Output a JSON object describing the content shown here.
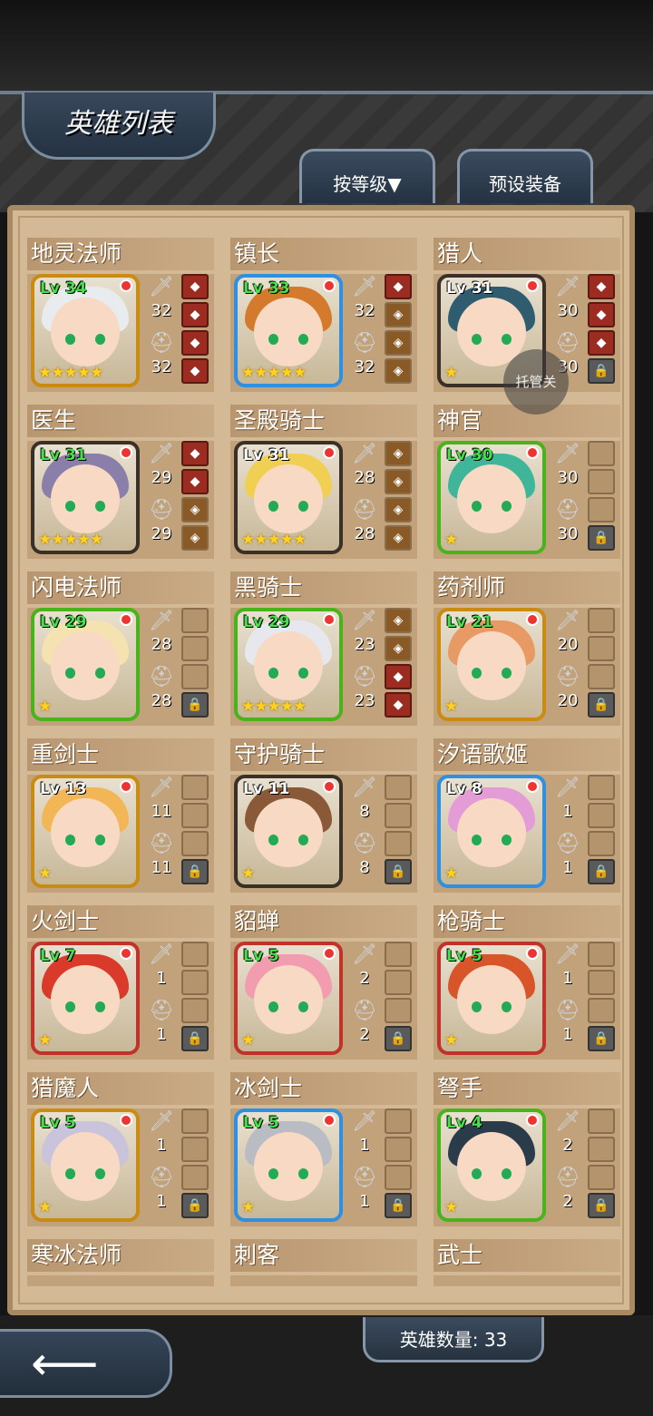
{
  "header": {
    "title": "英雄列表"
  },
  "tabs": {
    "sort_label": "按等级▼",
    "preset_label": "预设装备"
  },
  "footer": {
    "hero_count": "英雄数量: 33"
  },
  "overlay": {
    "label": "托管关"
  },
  "colors": {
    "green_frame": "#4ab31c",
    "blue_frame": "#2f8fe0",
    "gold_frame": "#c98b12",
    "red_frame": "#c0322a",
    "dark_frame": "#3a3028"
  },
  "heroes": [
    {
      "name": "地灵法师",
      "level": "Lv 34",
      "atk": "32",
      "def": "32",
      "stars": 5,
      "frame": "#c98b12",
      "hair": "#e9ecef",
      "lvwhite": false,
      "slots": [
        "f",
        "f",
        "f",
        "f"
      ]
    },
    {
      "name": "镇长",
      "level": "Lv 33",
      "atk": "32",
      "def": "32",
      "stars": 5,
      "frame": "#2f8fe0",
      "hair": "#d47a2c",
      "lvwhite": false,
      "slots": [
        "f",
        "b",
        "b",
        "b"
      ]
    },
    {
      "name": "猎人",
      "level": "Lv 31",
      "atk": "30",
      "def": "30",
      "stars": 1,
      "frame": "#3a3028",
      "hair": "#2f5c6e",
      "lvwhite": true,
      "slots": [
        "f",
        "f",
        "f",
        "lock"
      ]
    },
    {
      "name": "医生",
      "level": "Lv 31",
      "atk": "29",
      "def": "29",
      "stars": 5,
      "frame": "#3a3028",
      "hair": "#8a7fa8",
      "lvwhite": false,
      "slots": [
        "f",
        "f",
        "b",
        "b"
      ]
    },
    {
      "name": "圣殿骑士",
      "level": "Lv 31",
      "atk": "28",
      "def": "28",
      "stars": 5,
      "frame": "#3a3028",
      "hair": "#f0cf52",
      "lvwhite": true,
      "slots": [
        "b",
        "b",
        "b",
        "b"
      ]
    },
    {
      "name": "神官",
      "level": "Lv 30",
      "atk": "30",
      "def": "30",
      "stars": 1,
      "frame": "#4ab31c",
      "hair": "#3fb59a",
      "lvwhite": false,
      "slots": [
        "e",
        "e",
        "e",
        "lock"
      ]
    },
    {
      "name": "闪电法师",
      "level": "Lv 29",
      "atk": "28",
      "def": "28",
      "stars": 1,
      "frame": "#4ab31c",
      "hair": "#f4e3b0",
      "lvwhite": false,
      "slots": [
        "e",
        "e",
        "e",
        "lock"
      ]
    },
    {
      "name": "黑骑士",
      "level": "Lv 29",
      "atk": "23",
      "def": "23",
      "stars": 5,
      "frame": "#4ab31c",
      "hair": "#e7e7ee",
      "lvwhite": false,
      "slots": [
        "b",
        "b",
        "f",
        "f"
      ]
    },
    {
      "name": "药剂师",
      "level": "Lv 21",
      "atk": "20",
      "def": "20",
      "stars": 1,
      "frame": "#c98b12",
      "hair": "#e89a64",
      "lvwhite": false,
      "slots": [
        "e",
        "e",
        "e",
        "lock"
      ]
    },
    {
      "name": "重剑士",
      "level": "Lv 13",
      "atk": "11",
      "def": "11",
      "stars": 1,
      "frame": "#c98b12",
      "hair": "#f2b657",
      "lvwhite": true,
      "slots": [
        "e",
        "e",
        "e",
        "lock"
      ]
    },
    {
      "name": "守护骑士",
      "level": "Lv 11",
      "atk": "8",
      "def": "8",
      "stars": 1,
      "frame": "#3a3028",
      "hair": "#8a5a38",
      "lvwhite": true,
      "slots": [
        "e",
        "e",
        "e",
        "lock"
      ]
    },
    {
      "name": "汐语歌姬",
      "level": "Lv 8",
      "atk": "1",
      "def": "1",
      "stars": 1,
      "frame": "#2f8fe0",
      "hair": "#e49cd6",
      "lvwhite": true,
      "slots": [
        "e",
        "e",
        "e",
        "lock"
      ]
    },
    {
      "name": "火剑士",
      "level": "Lv 7",
      "atk": "1",
      "def": "1",
      "stars": 1,
      "frame": "#c0322a",
      "hair": "#d93a2a",
      "lvwhite": false,
      "slots": [
        "e",
        "e",
        "e",
        "lock"
      ]
    },
    {
      "name": "貂蝉",
      "level": "Lv 5",
      "atk": "2",
      "def": "2",
      "stars": 1,
      "frame": "#c0322a",
      "hair": "#f29cb0",
      "lvwhite": false,
      "slots": [
        "e",
        "e",
        "e",
        "lock"
      ]
    },
    {
      "name": "枪骑士",
      "level": "Lv 5",
      "atk": "1",
      "def": "1",
      "stars": 1,
      "frame": "#c0322a",
      "hair": "#d8552a",
      "lvwhite": false,
      "slots": [
        "e",
        "e",
        "e",
        "lock"
      ]
    },
    {
      "name": "猎魔人",
      "level": "Lv 5",
      "atk": "1",
      "def": "1",
      "stars": 1,
      "frame": "#c98b12",
      "hair": "#c9c3dc",
      "lvwhite": false,
      "slots": [
        "e",
        "e",
        "e",
        "lock"
      ]
    },
    {
      "name": "冰剑士",
      "level": "Lv 5",
      "atk": "1",
      "def": "1",
      "stars": 1,
      "frame": "#2f8fe0",
      "hair": "#b9bcc2",
      "lvwhite": false,
      "slots": [
        "e",
        "e",
        "e",
        "lock"
      ]
    },
    {
      "name": "弩手",
      "level": "Lv 4",
      "atk": "2",
      "def": "2",
      "stars": 1,
      "frame": "#4ab31c",
      "hair": "#2a3b4a",
      "lvwhite": false,
      "slots": [
        "e",
        "e",
        "e",
        "lock"
      ]
    },
    {
      "name": "寒冰法师"
    },
    {
      "name": "刺客"
    },
    {
      "name": "武士"
    }
  ]
}
